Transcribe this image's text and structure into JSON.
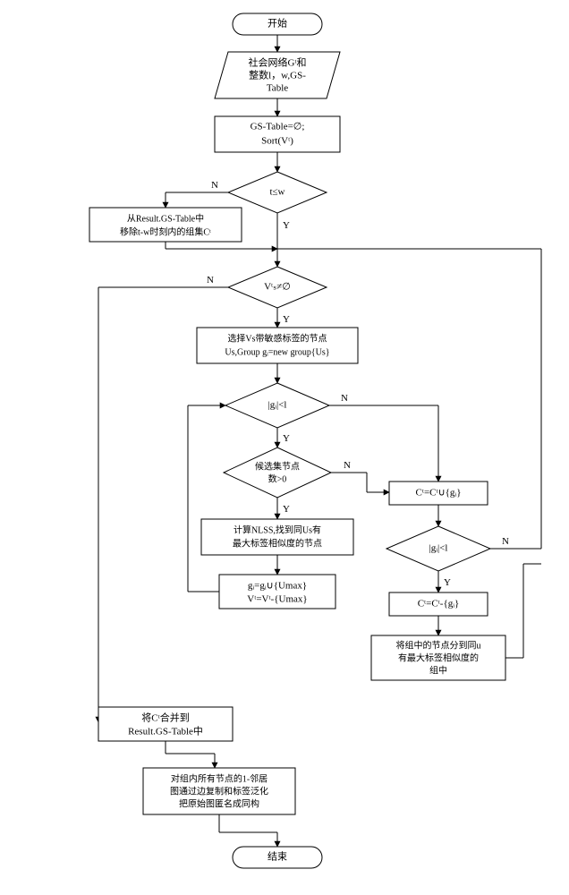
{
  "nodes": {
    "start": "开始",
    "input1": "社会网络Gᵗ和",
    "input2": "整数l，w,GS-",
    "input3": "Table",
    "init1": "GS-Table=∅;",
    "init2": "Sort(Vᵗ)",
    "d_tw": "t≤w",
    "remove1": "从Result.GS-Table中",
    "remove2": "移除t-w时刻内的组集Cᵗ",
    "d_vs": "Vᵗₛ≠∅",
    "select1": "选择Vs带敏感标签的节点",
    "select2": "Us,Group gᵢ=new group{Us}",
    "d_gi1": "|gᵢ|<l",
    "d_cand1": "候选集节点",
    "d_cand2": "数>0",
    "union_c": "Cᵗ=Cᵗ∪{gᵢ}",
    "nlss1": "计算NLSS,找到同Us有",
    "nlss2": "最大标签相似度的节点",
    "add1": "gᵢ=gᵢ∪{Umax}",
    "add2": "Vᵗ=Vᵗ-{Umax}",
    "d_gi2": "|gᵢ|<l",
    "minus_c": "Cᵗ=Cᵗ-{gᵢ}",
    "dist1": "将组中的节点分到同u",
    "dist2": "有最大标签相似度的",
    "dist3": "组中",
    "merge1": "将Cᵗ合并到",
    "merge2": "Result.GS-Table中",
    "iso1": "对组内所有节点的1-邻居",
    "iso2": "图通过边复制和标签泛化",
    "iso3": "把原始图匿名成同构",
    "end": "结束",
    "Y": "Y",
    "N": "N"
  }
}
